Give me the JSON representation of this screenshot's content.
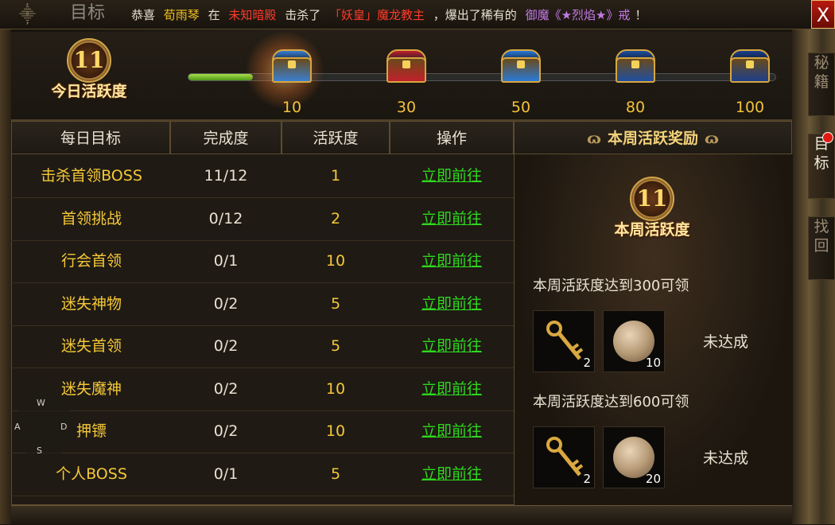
{
  "header": {
    "title": "目标",
    "notice": {
      "prefix": "恭喜",
      "player": "荀雨琴",
      "at": "在",
      "place": "未知暗殿",
      "killed": "击杀了",
      "boss": "「妖皇」魔龙教主",
      "dropped": "，爆出了稀有的",
      "item": "御魔《★烈焰★》戒",
      "end": "！"
    },
    "close_label": "X"
  },
  "daily_activity": {
    "badge_number": "11",
    "badge_label": "今日活跃度",
    "progress": 0.11,
    "chests": [
      {
        "threshold": "10",
        "color": "#3a7fd0"
      },
      {
        "threshold": "30",
        "color": "#c0202a"
      },
      {
        "threshold": "50",
        "color": "#2a7ad8"
      },
      {
        "threshold": "80",
        "color": "#1e4fa0"
      },
      {
        "threshold": "100",
        "color": "#1c3f8a"
      }
    ]
  },
  "table": {
    "headers": [
      "每日目标",
      "完成度",
      "活跃度",
      "操作"
    ],
    "rows": [
      {
        "name": "击杀首领BOSS",
        "progress": "11/12",
        "activity": "1",
        "action": "立即前往"
      },
      {
        "name": "首领挑战",
        "progress": "0/12",
        "activity": "2",
        "action": "立即前往"
      },
      {
        "name": "行会首领",
        "progress": "0/1",
        "activity": "10",
        "action": "立即前往"
      },
      {
        "name": "迷失神物",
        "progress": "0/2",
        "activity": "5",
        "action": "立即前往"
      },
      {
        "name": "迷失首领",
        "progress": "0/2",
        "activity": "5",
        "action": "立即前往"
      },
      {
        "name": "迷失魔神",
        "progress": "0/2",
        "activity": "10",
        "action": "立即前往"
      },
      {
        "name": "押镖",
        "progress": "0/2",
        "activity": "10",
        "action": "立即前往"
      },
      {
        "name": "个人BOSS",
        "progress": "0/1",
        "activity": "5",
        "action": "立即前往"
      }
    ]
  },
  "weekly": {
    "title": "本周活跃奖励",
    "title_deco_left": "ɷ",
    "title_deco_right": "ɷ",
    "badge_number": "11",
    "badge_label": "本周活跃度",
    "tiers": [
      {
        "requirement": "本周活跃度达到300可领",
        "key_count": "2",
        "orb_count": "10",
        "status": "未达成"
      },
      {
        "requirement": "本周活跃度达到600可领",
        "key_count": "2",
        "orb_count": "20",
        "status": "未达成"
      }
    ]
  },
  "side_tabs": [
    {
      "label": "秘\n籍"
    },
    {
      "label": "目\n标"
    },
    {
      "label": "找\n回"
    }
  ],
  "joystick": {
    "w": "W",
    "a": "A",
    "s": "S",
    "d": "D"
  },
  "colors": {
    "accent_gold": "#f4c838",
    "link_green": "#2fd81f",
    "alert_red": "#ff3a2a",
    "rare_purple": "#c27ae6"
  }
}
